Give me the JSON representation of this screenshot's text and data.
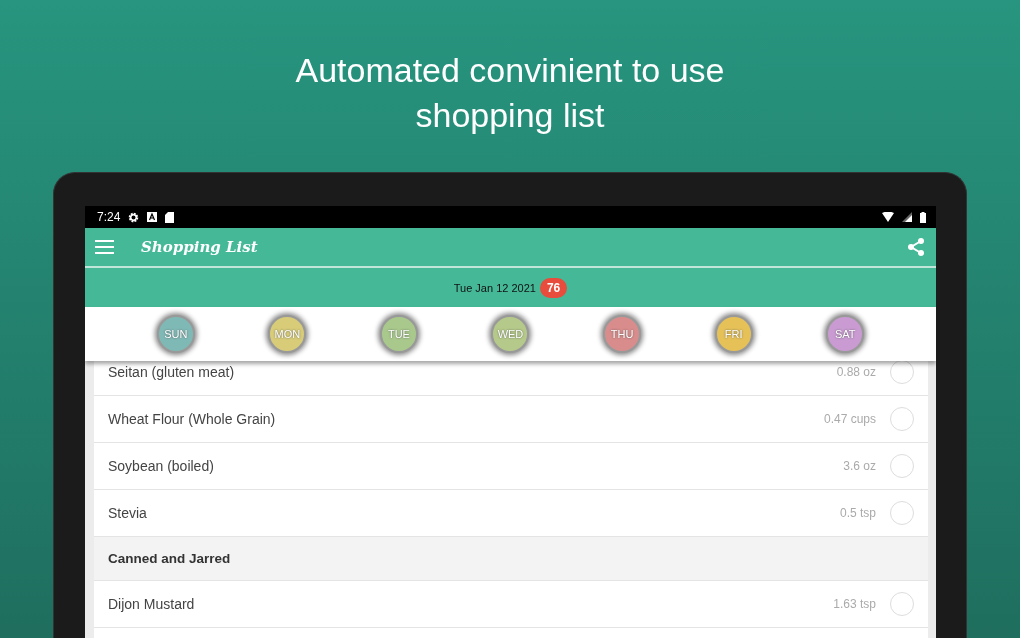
{
  "headline": "Automated convinient to use shopping list",
  "status_bar": {
    "time": "7:24"
  },
  "app_bar": {
    "title": "Shopping List"
  },
  "date_bar": {
    "date": "Tue Jan 12 2021",
    "count": "76"
  },
  "days": [
    {
      "label": "SUN",
      "color": "#7fb9b6"
    },
    {
      "label": "MON",
      "color": "#d8cc78"
    },
    {
      "label": "TUE",
      "color": "#a9c98c"
    },
    {
      "label": "WED",
      "color": "#b5ca8a"
    },
    {
      "label": "THU",
      "color": "#d98c8c"
    },
    {
      "label": "FRI",
      "color": "#e5c158"
    },
    {
      "label": "SAT",
      "color": "#c99bd2"
    }
  ],
  "list": [
    {
      "kind": "item",
      "name": "Seitan (gluten meat)",
      "amount": "0.88 oz",
      "checked": false
    },
    {
      "kind": "item",
      "name": "Wheat Flour (Whole Grain)",
      "amount": "0.47 cups",
      "checked": false
    },
    {
      "kind": "item",
      "name": "Soybean (boiled)",
      "amount": "3.6 oz",
      "checked": false
    },
    {
      "kind": "item",
      "name": "Stevia",
      "amount": "0.5 tsp",
      "checked": false
    },
    {
      "kind": "category",
      "name": "Canned and Jarred"
    },
    {
      "kind": "item",
      "name": "Dijon Mustard",
      "amount": "1.63 tsp",
      "checked": false
    }
  ]
}
